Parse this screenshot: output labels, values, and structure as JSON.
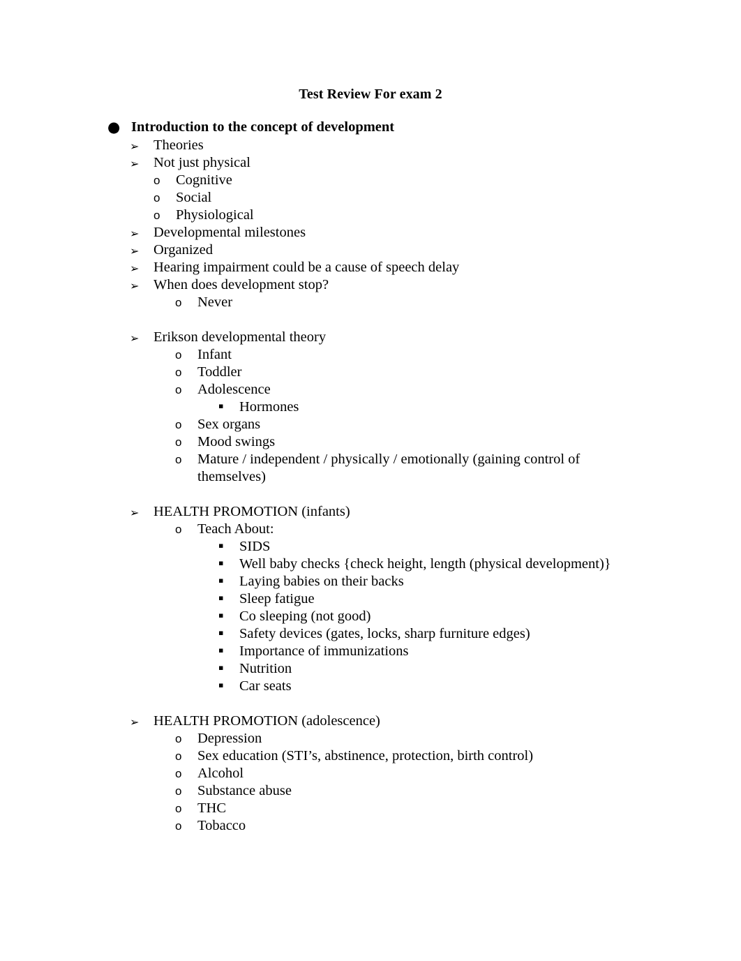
{
  "document": {
    "title": "Test Review For exam 2",
    "bullet_glyphs": {
      "level1": "●",
      "level2": "➢",
      "level3": "o",
      "level4": "▪"
    },
    "blocks": [
      {
        "level": 1,
        "text": "Introduction to the concept of development"
      },
      {
        "level": 2,
        "text": "Theories"
      },
      {
        "level": 2,
        "text": "Not just physical"
      },
      {
        "level": "3a",
        "text": "Cognitive"
      },
      {
        "level": "3a",
        "text": "Social"
      },
      {
        "level": "3a",
        "text": "Physiological"
      },
      {
        "level": 2,
        "text": "Developmental milestones"
      },
      {
        "level": 2,
        "text": "Organized"
      },
      {
        "level": 2,
        "text": "Hearing impairment could be a cause of speech delay"
      },
      {
        "level": 2,
        "text": "When does development stop?"
      },
      {
        "level": "3b",
        "text": "Never"
      },
      {
        "level": "spacer"
      },
      {
        "level": 2,
        "text": "Erikson developmental theory"
      },
      {
        "level": "3b",
        "text": "Infant"
      },
      {
        "level": "3b",
        "text": "Toddler"
      },
      {
        "level": "3b",
        "text": "Adolescence"
      },
      {
        "level": 4,
        "text": "Hormones"
      },
      {
        "level": "3b",
        "text": "Sex organs"
      },
      {
        "level": "3b",
        "text": "Mood swings"
      },
      {
        "level": "3b",
        "text": "Mature / independent / physically / emotionally (gaining control of themselves)"
      },
      {
        "level": "spacer"
      },
      {
        "level": 2,
        "text": "HEALTH PROMOTION (infants)"
      },
      {
        "level": "3b",
        "text": "Teach About:"
      },
      {
        "level": 4,
        "text": "SIDS"
      },
      {
        "level": 4,
        "text": "Well baby checks {check height, length (physical development)}"
      },
      {
        "level": 4,
        "text": "Laying babies on their backs"
      },
      {
        "level": 4,
        "text": "Sleep fatigue"
      },
      {
        "level": 4,
        "text": "Co sleeping (not good)"
      },
      {
        "level": 4,
        "text": "Safety devices (gates, locks, sharp furniture edges)"
      },
      {
        "level": 4,
        "text": "Importance of immunizations"
      },
      {
        "level": 4,
        "text": "Nutrition"
      },
      {
        "level": 4,
        "text": "Car seats"
      },
      {
        "level": "spacer"
      },
      {
        "level": 2,
        "text": "HEALTH PROMOTION (adolescence)"
      },
      {
        "level": "3b",
        "text": "Depression"
      },
      {
        "level": "3b",
        "text": "Sex education (STI’s, abstinence, protection, birth control)"
      },
      {
        "level": "3b",
        "text": "Alcohol"
      },
      {
        "level": "3b",
        "text": "Substance abuse"
      },
      {
        "level": "3b",
        "text": "THC"
      },
      {
        "level": "3b",
        "text": "Tobacco"
      }
    ]
  }
}
